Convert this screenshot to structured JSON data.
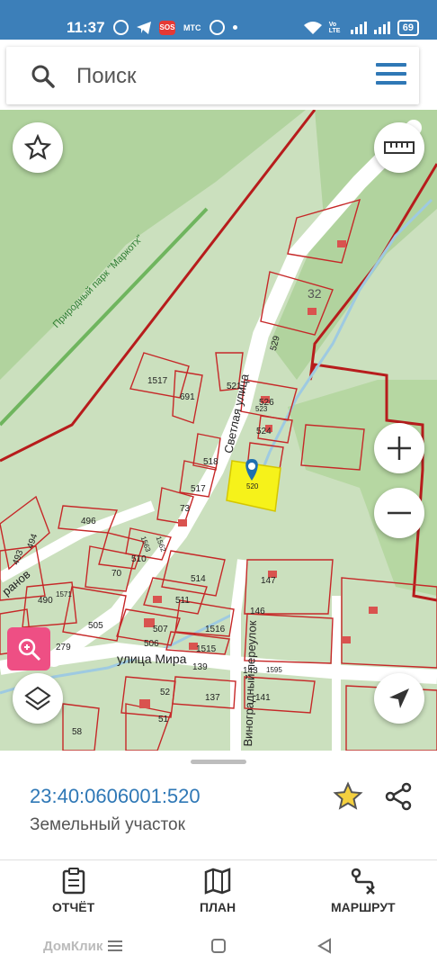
{
  "status": {
    "time": "11:37",
    "battery": "69",
    "sos": "SOS",
    "mts": "МТС",
    "volte": "Vo LTE"
  },
  "search": {
    "placeholder": "Поиск"
  },
  "map": {
    "park_label": "Природный парк \"Маркотх\"",
    "streets": {
      "svetlaya": "Светлая улица",
      "mira": "улица Мира",
      "vinogradny": "Виноградный переулок",
      "partial": "ранов"
    },
    "house_number": "32",
    "parcels": [
      "1517",
      "691",
      "521",
      "526",
      "523",
      "524",
      "518",
      "517",
      "520",
      "73",
      "496",
      "510",
      "1563",
      "1562",
      "70",
      "514",
      "1571",
      "511",
      "505",
      "507",
      "1516",
      "506",
      "1515",
      "279",
      "139",
      "143",
      "1595",
      "147",
      "146",
      "52",
      "137",
      "141",
      "51",
      "490",
      "493",
      "494",
      "58",
      "529"
    ]
  },
  "selected": {
    "cadastral_number": "23:40:0606001:520",
    "object_type": "Земельный участок"
  },
  "nav": {
    "report": "ОТЧЁТ",
    "plan": "ПЛАН",
    "route": "МАРШРУТ"
  },
  "watermark": "ДомКлик",
  "colors": {
    "accent": "#2f78b6",
    "parcel_border": "#c62828",
    "highlight": "#f6f21a",
    "forest": "#a9cf95",
    "meadow": "#cbe0be"
  },
  "icons": {
    "favorite": "star-icon",
    "ruler": "ruler-icon",
    "zoom_in": "plus-icon",
    "zoom_out": "minus-icon",
    "layers": "layers-icon",
    "locate": "navigation-arrow-icon",
    "share": "share-icon"
  }
}
